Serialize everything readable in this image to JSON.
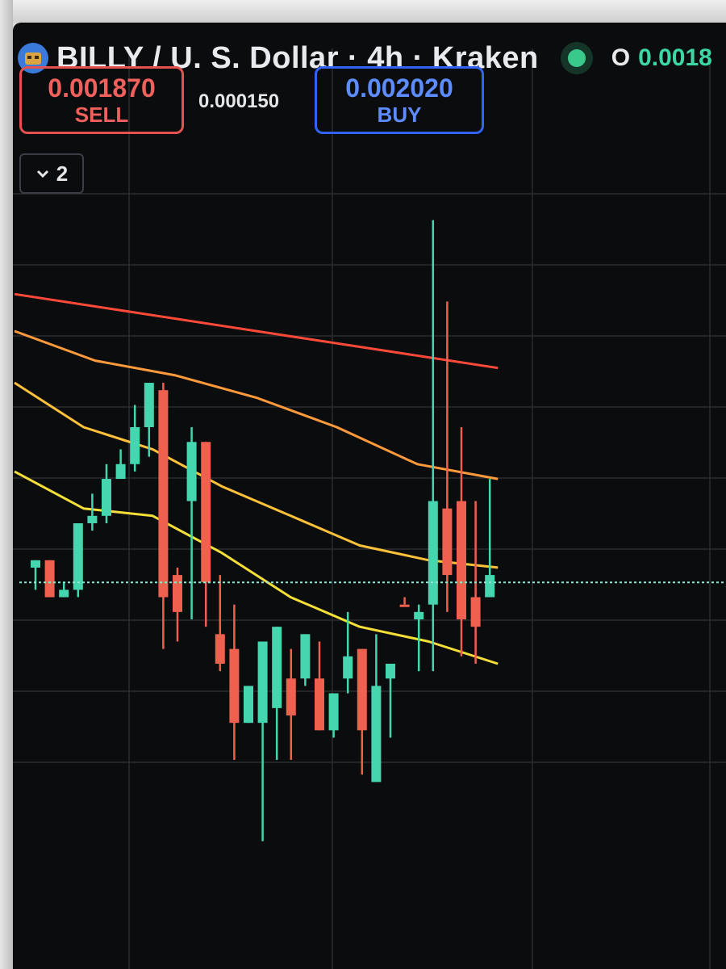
{
  "header": {
    "symbol_title": "BILLY / U. S. Dollar · 4h · Kraken",
    "logo_icon": "billy-token-icon",
    "status": "market-open-dot",
    "open_label": "O",
    "open_value": "0.0018"
  },
  "trade_panel": {
    "sell_price": "0.001870",
    "sell_label": "SELL",
    "spread": "0.000150",
    "buy_price": "0.002020",
    "buy_label": "BUY"
  },
  "indicators_toggle": {
    "icon": "chevron-down-icon",
    "count": "2"
  },
  "colors": {
    "background": "#0b0c0e",
    "up": "#45d6b0",
    "down": "#f0604e",
    "ma_red": "#ff4a3a",
    "ma_orange": "#ff9a3c",
    "ma_gold": "#ffc13a",
    "ma_yellow": "#f4de38",
    "price_line": "#8fe7d4"
  },
  "chart_data": {
    "type": "candlestick",
    "title": "BILLY / U. S. Dollar · 4h · Kraken",
    "price_scale_visible": false,
    "current_price_line": 0.00187,
    "candles": [
      {
        "o": 0.00189,
        "h": 0.0019,
        "l": 0.00186,
        "c": 0.0019,
        "dir": "up"
      },
      {
        "o": 0.0019,
        "h": 0.0019,
        "l": 0.00185,
        "c": 0.00185,
        "dir": "down"
      },
      {
        "o": 0.00185,
        "h": 0.00187,
        "l": 0.00185,
        "c": 0.00186,
        "dir": "up"
      },
      {
        "o": 0.00186,
        "h": 0.00195,
        "l": 0.00185,
        "c": 0.00195,
        "dir": "up"
      },
      {
        "o": 0.00195,
        "h": 0.00199,
        "l": 0.00194,
        "c": 0.00196,
        "dir": "up"
      },
      {
        "o": 0.00196,
        "h": 0.00203,
        "l": 0.00195,
        "c": 0.00201,
        "dir": "up"
      },
      {
        "o": 0.00201,
        "h": 0.00205,
        "l": 0.00201,
        "c": 0.00203,
        "dir": "up"
      },
      {
        "o": 0.00203,
        "h": 0.00211,
        "l": 0.00202,
        "c": 0.00208,
        "dir": "up"
      },
      {
        "o": 0.00208,
        "h": 0.00214,
        "l": 0.00204,
        "c": 0.00214,
        "dir": "up"
      },
      {
        "o": 0.00213,
        "h": 0.00214,
        "l": 0.00178,
        "c": 0.00185,
        "dir": "down"
      },
      {
        "o": 0.00188,
        "h": 0.00189,
        "l": 0.00179,
        "c": 0.00183,
        "dir": "down"
      },
      {
        "o": 0.00198,
        "h": 0.00208,
        "l": 0.00182,
        "c": 0.00206,
        "dir": "up"
      },
      {
        "o": 0.00206,
        "h": 0.00206,
        "l": 0.00181,
        "c": 0.00187,
        "dir": "down"
      },
      {
        "o": 0.0018,
        "h": 0.00188,
        "l": 0.00175,
        "c": 0.00176,
        "dir": "down"
      },
      {
        "o": 0.00178,
        "h": 0.00184,
        "l": 0.00163,
        "c": 0.00168,
        "dir": "down"
      },
      {
        "o": 0.00168,
        "h": 0.00173,
        "l": 0.00168,
        "c": 0.00173,
        "dir": "up"
      },
      {
        "o": 0.00168,
        "h": 0.00179,
        "l": 0.00152,
        "c": 0.00179,
        "dir": "up"
      },
      {
        "o": 0.0017,
        "h": 0.00181,
        "l": 0.00163,
        "c": 0.00181,
        "dir": "up"
      },
      {
        "o": 0.00174,
        "h": 0.00178,
        "l": 0.00163,
        "c": 0.00169,
        "dir": "down"
      },
      {
        "o": 0.00174,
        "h": 0.0018,
        "l": 0.00173,
        "c": 0.0018,
        "dir": "up"
      },
      {
        "o": 0.00174,
        "h": 0.00179,
        "l": 0.00167,
        "c": 0.00167,
        "dir": "down"
      },
      {
        "o": 0.00167,
        "h": 0.00172,
        "l": 0.00166,
        "c": 0.00172,
        "dir": "up"
      },
      {
        "o": 0.00174,
        "h": 0.00183,
        "l": 0.00172,
        "c": 0.00177,
        "dir": "up"
      },
      {
        "o": 0.00178,
        "h": 0.00178,
        "l": 0.00161,
        "c": 0.00167,
        "dir": "down"
      },
      {
        "o": 0.0016,
        "h": 0.0018,
        "l": 0.0016,
        "c": 0.00173,
        "dir": "up"
      },
      {
        "o": 0.00174,
        "h": 0.00176,
        "l": 0.00166,
        "c": 0.00176,
        "dir": "up"
      },
      {
        "o": 0.00184,
        "h": 0.00185,
        "l": 0.00184,
        "c": 0.00184,
        "dir": "down"
      },
      {
        "o": 0.00182,
        "h": 0.00184,
        "l": 0.00175,
        "c": 0.00183,
        "dir": "up"
      },
      {
        "o": 0.00184,
        "h": 0.00236,
        "l": 0.00175,
        "c": 0.00198,
        "dir": "up"
      },
      {
        "o": 0.00197,
        "h": 0.00225,
        "l": 0.00183,
        "c": 0.00188,
        "dir": "down"
      },
      {
        "o": 0.00198,
        "h": 0.00208,
        "l": 0.00177,
        "c": 0.00182,
        "dir": "down"
      },
      {
        "o": 0.00185,
        "h": 0.00198,
        "l": 0.00176,
        "c": 0.00181,
        "dir": "down"
      },
      {
        "o": 0.00185,
        "h": 0.00201,
        "l": 0.00185,
        "c": 0.00188,
        "dir": "up"
      }
    ],
    "moving_averages": [
      {
        "color_key": "ma_red",
        "values": [
          0.00226,
          0.00224,
          0.00222,
          0.0022,
          0.00218,
          0.00216
        ]
      },
      {
        "color_key": "ma_orange",
        "values": [
          0.00221,
          0.00217,
          0.00215,
          0.00212,
          0.00208,
          0.00203,
          0.00201
        ]
      },
      {
        "color_key": "ma_gold",
        "values": [
          0.00214,
          0.00208,
          0.00205,
          0.002,
          0.00196,
          0.00192,
          0.0019,
          0.00189
        ]
      },
      {
        "color_key": "ma_yellow",
        "values": [
          0.00202,
          0.00197,
          0.00196,
          0.00191,
          0.00185,
          0.00181,
          0.00179,
          0.00176
        ]
      }
    ]
  }
}
